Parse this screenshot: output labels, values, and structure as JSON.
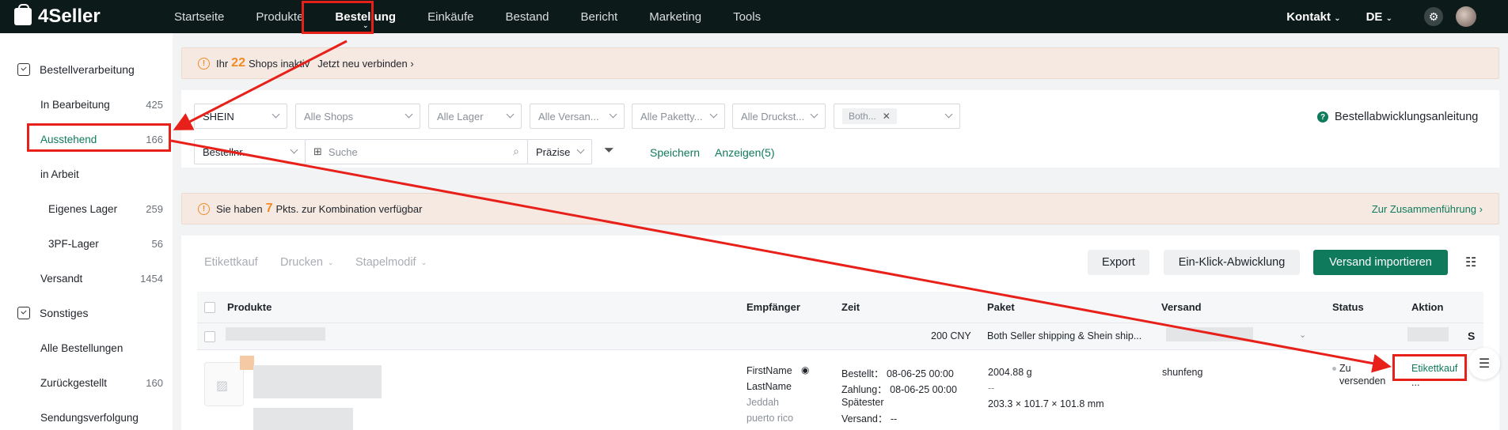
{
  "app": {
    "logo": "4Seller"
  },
  "topnav": {
    "items": [
      "Startseite",
      "Produkte",
      "Bestellung",
      "Einkäufe",
      "Bestand",
      "Bericht",
      "Marketing",
      "Tools"
    ],
    "active": "Bestellung",
    "kontakt": "Kontakt",
    "lang": "DE"
  },
  "sidebar": {
    "group1": "Bestellverarbeitung",
    "items1": [
      {
        "label": "In Bearbeitung",
        "count": "425"
      },
      {
        "label": "Ausstehend",
        "count": "166"
      },
      {
        "label": "in Arbeit",
        "count": ""
      },
      {
        "label": "Eigenes Lager",
        "count": "259"
      },
      {
        "label": "3PF-Lager",
        "count": "56"
      },
      {
        "label": "Versandt",
        "count": "1454"
      }
    ],
    "group2": "Sonstiges",
    "items2": [
      {
        "label": "Alle Bestellungen",
        "count": ""
      },
      {
        "label": "Zurückgestellt",
        "count": "160"
      },
      {
        "label": "Sendungsverfolgung",
        "count": ""
      }
    ]
  },
  "alert1": {
    "prefix": "Ihr",
    "count": "22",
    "middle": "Shops inaktiv",
    "link": "Jetzt neu verbinden"
  },
  "filters": {
    "platform": "SHEIN",
    "shops": "Alle Shops",
    "lager": "Alle Lager",
    "versand": "Alle Versan...",
    "paket": "Alle Paketty...",
    "druck": "Alle Druckst...",
    "tag": "Both...",
    "search_type": "Bestellnr.",
    "search_placeholder": "Suche",
    "precision": "Präzise",
    "save": "Speichern",
    "show": "Anzeigen(5)",
    "help": "Bestellabwicklungsanleitung"
  },
  "alert2": {
    "prefix": "Sie haben",
    "count": "7",
    "middle": "Pkts. zur Kombination verfügbar",
    "link": "Zur Zusammenführung"
  },
  "toolbar": {
    "etikettkauf": "Etikettkauf",
    "drucken": "Drucken",
    "stapel": "Stapelmodif",
    "export": "Export",
    "oneclick": "Ein-Klick-Abwicklung",
    "import": "Versand importieren"
  },
  "table": {
    "headers": [
      "Produkte",
      "Empfänger",
      "Zeit",
      "Paket",
      "Versand",
      "Status",
      "Aktion"
    ],
    "group": {
      "amount": "200 CNY",
      "shipping": "Both Seller shipping & Shein ship...",
      "s": "S"
    },
    "row": {
      "first": "FirstName",
      "last": "LastName",
      "city": "Jeddah",
      "region": "puerto rico",
      "bestellt_label": "Bestellt：",
      "bestellt": "08-06-25 00:00",
      "zahlung_label": "Zahlung：",
      "zahlung": "08-06-25 00:00",
      "spaet1": "Spätester",
      "spaet2": "Versand：",
      "spaet_val": "--",
      "weight": "2004.88 g",
      "dash": "--",
      "dims": "203.3 × 101.7 × 101.8 mm",
      "carrier": "shunfeng",
      "status1": "Zu",
      "status2": "versenden",
      "action": "Etikettkauf",
      "more": "..."
    }
  }
}
